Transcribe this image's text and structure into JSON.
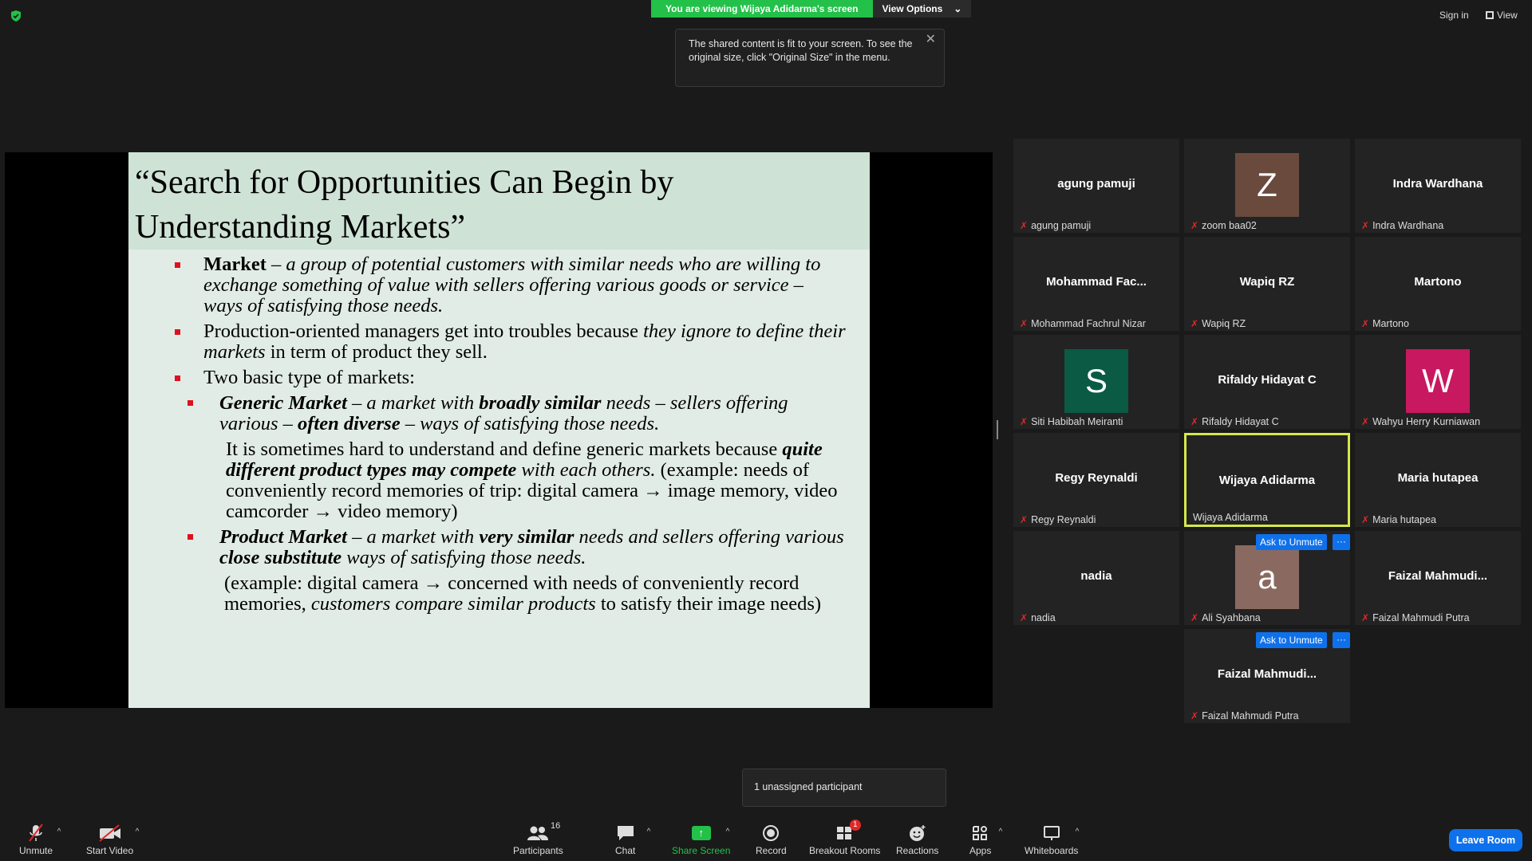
{
  "top": {
    "viewing_text": "You are viewing Wijaya Adidarma's screen",
    "view_options": "View Options",
    "tooltip_text": "The shared content is fit to your screen. To see the original size, click \"Original Size\" in the menu.",
    "sign_in": "Sign in",
    "view": "View"
  },
  "slide": {
    "title": "“Search for Opportunities Can Begin by Understanding Markets”",
    "b1_term": "Market",
    "b1_def": " – a group of potential customers with similar needs who are willing to exchange something of value with sellers offering various goods or service – ways of satisfying those needs.",
    "b2_plain": "Production-oriented managers get into troubles because ",
    "b2_italic": "they ignore to define their markets",
    "b2_tail": " in term of product they sell.",
    "b3": "Two basic type of markets:",
    "s1_term": "Generic Market",
    "s1_a": " – a market with ",
    "s1_b": "broadly similar",
    "s1_c": " needs – sellers offering various – ",
    "s1_d": "often diverse",
    "s1_e": " – ways of satisfying those needs.",
    "s1_p1": "It is sometimes hard to understand and define generic markets because ",
    "s1_p2": "quite different product types may compete",
    "s1_p3": " with each ",
    "s1_p4": "others.",
    "s1_p5": " (example: needs of conveniently record memories of trip: digital camera → image memory, video camcorder → video memory)",
    "s2_term": "Product Market",
    "s2_a": " – a market with ",
    "s2_b": "very similar",
    "s2_c": " needs and sellers offering various ",
    "s2_d": "close substitute",
    "s2_e": " ways of satisfying those needs.",
    "s2_p1": "(example: digital camera → concerned with needs of conveniently record memories, ",
    "s2_p2": "customers compare similar products",
    "s2_p3": " to satisfy their image needs)"
  },
  "gallery": {
    "tiles": [
      {
        "name": "agung pamuji",
        "label": "agung pamuji"
      },
      {
        "name": "Z",
        "label": "zoom baa02"
      },
      {
        "name": "Indra Wardhana",
        "label": "Indra Wardhana"
      },
      {
        "name": "Mohammad  Fac...",
        "label": "Mohammad Fachrul Nizar"
      },
      {
        "name": "Wapiq RZ",
        "label": "Wapiq RZ"
      },
      {
        "name": "Martono",
        "label": "Martono"
      },
      {
        "name": "S",
        "label": "Siti Habibah Meiranti"
      },
      {
        "name": "Rifaldy Hidayat C",
        "label": "Rifaldy Hidayat C"
      },
      {
        "name": "W",
        "label": "Wahyu Herry Kurniawan"
      },
      {
        "name": "Regy Reynaldi",
        "label": "Regy Reynaldi"
      },
      {
        "name": "Wijaya Adidarma",
        "label": "Wijaya Adidarma"
      },
      {
        "name": "Maria hutapea",
        "label": "Maria hutapea"
      },
      {
        "name": "nadia",
        "label": "nadia"
      },
      {
        "name": "a",
        "label": "Ali Syahbana"
      },
      {
        "name": "Faizal  Mahmudi...",
        "label": "Faizal Mahmudi Putra"
      },
      {
        "name": "Faizal  Mahmudi...",
        "label": "Faizal Mahmudi Putra"
      }
    ],
    "ask_to_unmute": "Ask to Unmute",
    "more": "···",
    "avatar_colors": {
      "Z": "#6b4a3e",
      "S": "#0b5a44",
      "W": "#c8185f",
      "a": "#8a6a60"
    }
  },
  "breakout_note": "1 unassigned participant",
  "toolbar": {
    "unmute": "Unmute",
    "start_video": "Start Video",
    "participants": "Participants",
    "participants_count": "16",
    "chat": "Chat",
    "share_screen": "Share Screen",
    "record": "Record",
    "breakout_rooms": "Breakout Rooms",
    "breakout_badge": "1",
    "reactions": "Reactions",
    "apps": "Apps",
    "whiteboards": "Whiteboards",
    "leave_room": "Leave Room"
  }
}
